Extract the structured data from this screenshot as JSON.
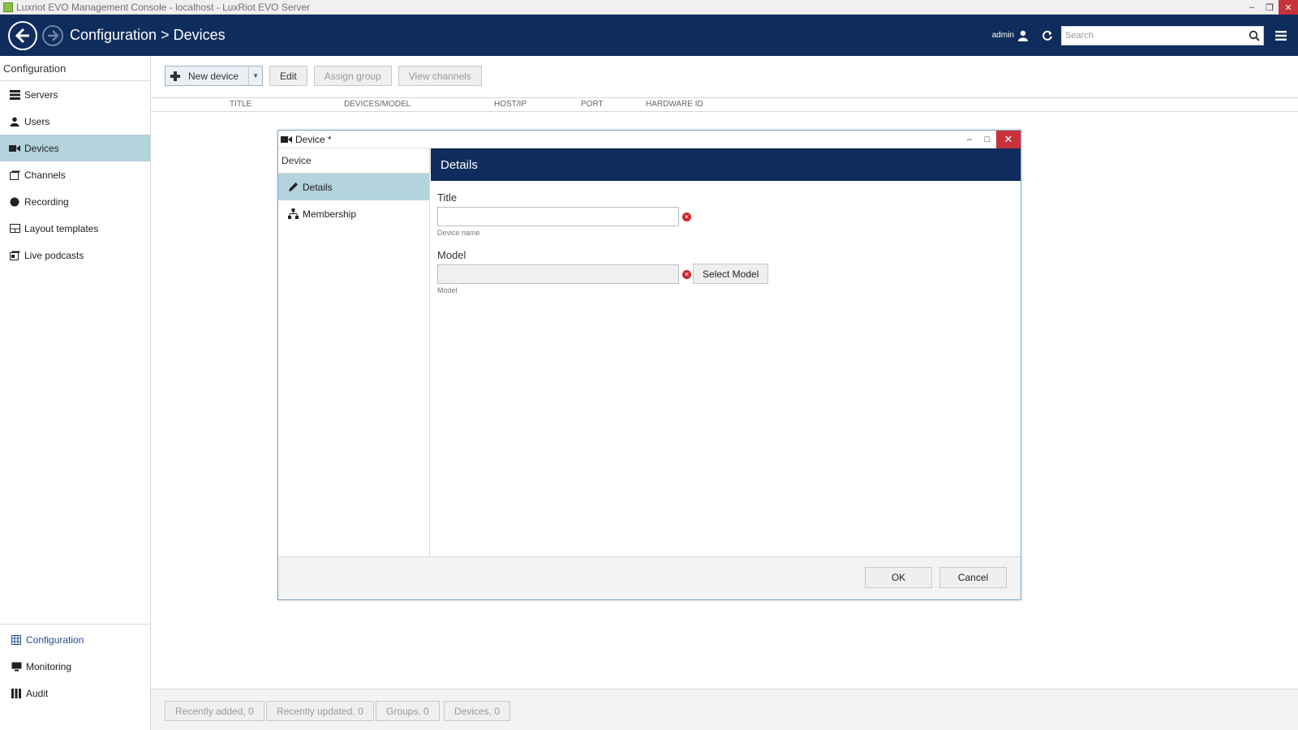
{
  "window": {
    "title": "Luxriot EVO Management Console - localhost - LuxRiot EVO Server",
    "controls": [
      "minimize-icon",
      "restore-icon",
      "close-icon"
    ]
  },
  "header": {
    "breadcrumb": "Configuration > Devices",
    "user": "admin",
    "search_placeholder": "Search"
  },
  "sidebar": {
    "heading": "Configuration",
    "items": [
      {
        "label": "Servers",
        "icon": "servers-icon"
      },
      {
        "label": "Users",
        "icon": "user-icon"
      },
      {
        "label": "Devices",
        "icon": "camera-icon",
        "active": true
      },
      {
        "label": "Channels",
        "icon": "channels-icon"
      },
      {
        "label": "Recording",
        "icon": "record-icon"
      },
      {
        "label": "Layout templates",
        "icon": "layout-icon"
      },
      {
        "label": "Live podcasts",
        "icon": "podcast-icon"
      }
    ],
    "bottom": [
      {
        "label": "Configuration",
        "icon": "grid-icon",
        "current": true
      },
      {
        "label": "Monitoring",
        "icon": "monitor-icon"
      },
      {
        "label": "Audit",
        "icon": "audit-icon"
      }
    ]
  },
  "toolbar": {
    "new_device": "New device",
    "edit": "Edit",
    "assign_group": "Assign group",
    "view_channels": "View channels"
  },
  "table": {
    "columns": [
      "TITLE",
      "DEVICES/MODEL",
      "HOST/IP",
      "PORT",
      "HARDWARE ID"
    ]
  },
  "statusbar": {
    "recently_added": "Recently added, 0",
    "recently_updated": "Recently updated, 0",
    "groups": "Groups, 0",
    "devices": "Devices, 0"
  },
  "dialog": {
    "title": "Device *",
    "left_heading": "Device",
    "nav": [
      {
        "label": "Details",
        "icon": "pencil-icon",
        "active": true
      },
      {
        "label": "Membership",
        "icon": "hierarchy-icon"
      }
    ],
    "section_title": "Details",
    "title_field": {
      "label": "Title",
      "value": "",
      "hint": "Device name"
    },
    "model_field": {
      "label": "Model",
      "value": "",
      "hint": "Model"
    },
    "select_model": "Select Model",
    "ok": "OK",
    "cancel": "Cancel"
  },
  "colors": {
    "header_bg": "#0f2d5c",
    "active_item": "#b3d3dd",
    "close_red": "#c8323a",
    "error_red": "#d0232a"
  }
}
